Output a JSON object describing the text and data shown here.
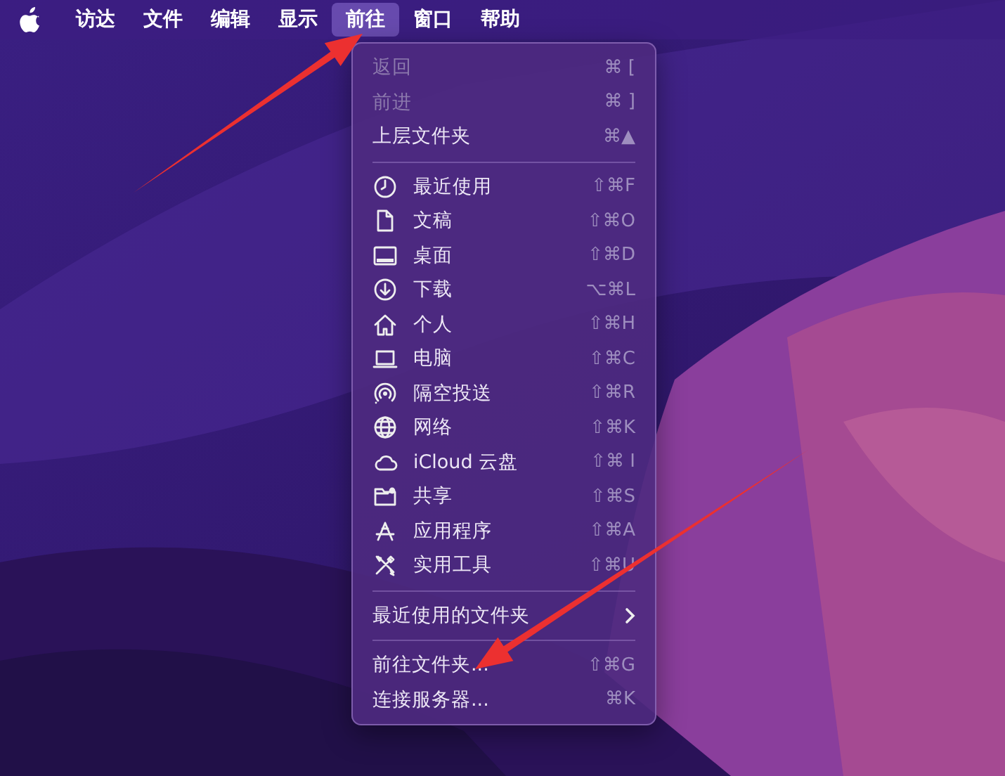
{
  "menubar": {
    "items": [
      {
        "label": "访达",
        "selected": false
      },
      {
        "label": "文件",
        "selected": false
      },
      {
        "label": "编辑",
        "selected": false
      },
      {
        "label": "显示",
        "selected": false
      },
      {
        "label": "前往",
        "selected": true
      },
      {
        "label": "窗口",
        "selected": false
      },
      {
        "label": "帮助",
        "selected": false
      }
    ]
  },
  "menu": {
    "sections": [
      {
        "items": [
          {
            "label": "返回",
            "shortcut": "⌘ [",
            "disabled": true
          },
          {
            "label": "前进",
            "shortcut": "⌘ ]",
            "disabled": true
          },
          {
            "label": "上层文件夹",
            "shortcut": "⌘▲",
            "disabled": false
          }
        ]
      },
      {
        "kind": "places",
        "items": [
          {
            "label": "最近使用",
            "shortcut": "⇧⌘F",
            "disabled": false
          },
          {
            "label": "文稿",
            "shortcut": "⇧⌘O",
            "disabled": false
          },
          {
            "label": "桌面",
            "shortcut": "⇧⌘D",
            "disabled": false
          },
          {
            "label": "下载",
            "shortcut": "⌥⌘L",
            "disabled": false
          },
          {
            "label": "个人",
            "shortcut": "⇧⌘H",
            "disabled": false
          },
          {
            "label": "电脑",
            "shortcut": "⇧⌘C",
            "disabled": false
          },
          {
            "label": "隔空投送",
            "shortcut": "⇧⌘R",
            "disabled": false
          },
          {
            "label": "网络",
            "shortcut": "⇧⌘K",
            "disabled": false
          },
          {
            "label": "iCloud 云盘",
            "shortcut": "⇧⌘ I",
            "disabled": false
          },
          {
            "label": "共享",
            "shortcut": "⇧⌘S",
            "disabled": false
          },
          {
            "label": "应用程序",
            "shortcut": "⇧⌘A",
            "disabled": false
          },
          {
            "label": "实用工具",
            "shortcut": "⇧⌘U",
            "disabled": false
          }
        ]
      },
      {
        "items": [
          {
            "label": "最近使用的文件夹",
            "submenu": true,
            "disabled": false
          }
        ]
      },
      {
        "items": [
          {
            "label": "前往文件夹...",
            "shortcut": "⇧⌘G",
            "disabled": false
          },
          {
            "label": "连接服务器...",
            "shortcut": "⌘K",
            "disabled": false
          }
        ]
      }
    ]
  },
  "callouts": [
    {
      "kind": "arrow"
    },
    {
      "kind": "arrow"
    }
  ]
}
